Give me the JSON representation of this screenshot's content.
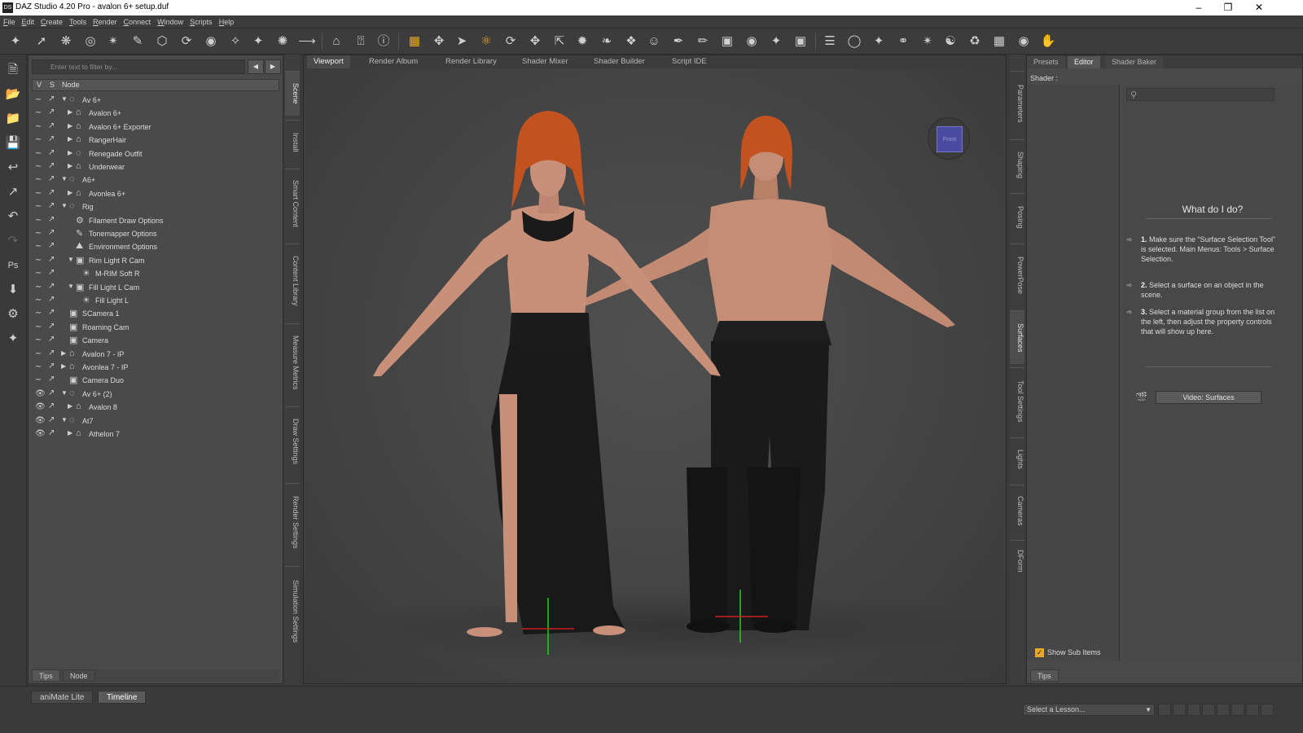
{
  "window": {
    "title": "DAZ Studio 4.20 Pro - avalon 6+ setup.duf",
    "app_icon": "DS",
    "controls": [
      "–",
      "❐",
      "✕"
    ]
  },
  "menu": [
    "File",
    "Edit",
    "Create",
    "Tools",
    "Render",
    "Connect",
    "Window",
    "Scripts",
    "Help"
  ],
  "scene_panel": {
    "filter_placeholder": "Enter text to filter by...",
    "nav_back": "◀",
    "nav_forward": "▶",
    "columns": {
      "v": "V",
      "s": "S",
      "node": "Node"
    },
    "nodes": [
      {
        "label": "Av 6+",
        "depth": 0,
        "expand": "▼",
        "icon": "◌"
      },
      {
        "label": "Avalon 6+",
        "depth": 1,
        "expand": "▶",
        "icon": "⌂"
      },
      {
        "label": "Avalon 6+ Exporter",
        "depth": 1,
        "expand": "▶",
        "icon": "⌂"
      },
      {
        "label": "RangerHair",
        "depth": 1,
        "expand": "▶",
        "icon": "⌂"
      },
      {
        "label": "Renegade Outfit",
        "depth": 1,
        "expand": "▶",
        "icon": "◌"
      },
      {
        "label": "Underwear",
        "depth": 1,
        "expand": "▶",
        "icon": "⌂"
      },
      {
        "label": "A6+",
        "depth": 0,
        "expand": "▼",
        "icon": "◌"
      },
      {
        "label": "Avonlea 6+",
        "depth": 1,
        "expand": "▶",
        "icon": "⌂"
      },
      {
        "label": "Rig",
        "depth": 0,
        "expand": "▼",
        "icon": "◌"
      },
      {
        "label": "Filament Draw Options",
        "depth": 1,
        "expand": "",
        "icon": "⚙"
      },
      {
        "label": "Tonemapper Options",
        "depth": 1,
        "expand": "",
        "icon": "✎"
      },
      {
        "label": "Environment Options",
        "depth": 1,
        "expand": "",
        "icon": "⛰"
      },
      {
        "label": "Rim Light R Cam",
        "depth": 1,
        "expand": "▼",
        "icon": "▣"
      },
      {
        "label": "M-RIM Soft R",
        "depth": 2,
        "expand": "",
        "icon": "☀"
      },
      {
        "label": "Fill Light L Cam",
        "depth": 1,
        "expand": "▼",
        "icon": "▣"
      },
      {
        "label": "Fill Light L",
        "depth": 2,
        "expand": "",
        "icon": "☀"
      },
      {
        "label": "SCamera 1",
        "depth": 0,
        "expand": "",
        "icon": "▣"
      },
      {
        "label": "Roaming Cam",
        "depth": 0,
        "expand": "",
        "icon": "▣"
      },
      {
        "label": "Camera",
        "depth": 0,
        "expand": "",
        "icon": "▣"
      },
      {
        "label": "Avalon 7 - IP",
        "depth": 0,
        "expand": "▶",
        "icon": "⌂"
      },
      {
        "label": "Avonlea 7 - IP",
        "depth": 0,
        "expand": "▶",
        "icon": "⌂"
      },
      {
        "label": "Camera Duo",
        "depth": 0,
        "expand": "",
        "icon": "▣"
      },
      {
        "label": "Av 6+ (2)",
        "depth": 0,
        "expand": "▼",
        "icon": "◌"
      },
      {
        "label": "Avalon 8",
        "depth": 1,
        "expand": "▶",
        "icon": "⌂"
      },
      {
        "label": "At7",
        "depth": 0,
        "expand": "▼",
        "icon": "◌"
      },
      {
        "label": "Athelon 7",
        "depth": 1,
        "expand": "▶",
        "icon": "⌂"
      }
    ],
    "bottom_tabs": [
      "Tips",
      "Node"
    ]
  },
  "left_vertical_tabs": [
    "Scene",
    "Install",
    "Smart Content",
    "Content Library",
    "Measure Metrics",
    "Draw Settings",
    "Render Settings",
    "Simulation Settings"
  ],
  "viewport_tabs": [
    "Viewport",
    "Render Album",
    "Render Library",
    "Shader Mixer",
    "Shader Builder",
    "Script IDE"
  ],
  "view_cube_label": "Front",
  "right_vertical_tabs": [
    "Parameters",
    "Shaping",
    "Posing",
    "PowerPose",
    "Surfaces",
    "Tool Settings",
    "Lights",
    "Cameras",
    "DForm"
  ],
  "surfaces_panel": {
    "tabs": [
      "Presets",
      "Editor",
      "Shader Baker"
    ],
    "shader_label": "Shader :",
    "help_title": "What do I do?",
    "steps": [
      {
        "num": "1.",
        "text": "Make sure the “Surface Selection Tool” is selected. Main Menus: Tools > Surface Selection."
      },
      {
        "num": "2.",
        "text": "Select a surface on an object in the scene."
      },
      {
        "num": "3.",
        "text": "Select a material group from the list on the left, then adjust the property controls that will show up here."
      }
    ],
    "video_button": "Video: Surfaces",
    "show_sub_items": "Show Sub Items",
    "tips_tab": "Tips"
  },
  "bottom_bar": {
    "tabs": [
      "aniMate Lite",
      "Timeline"
    ],
    "lesson_select": "Select a Lesson..."
  },
  "colors": {
    "accent": "#e8a928",
    "panel": "#4a4a4a",
    "background": "#3a3a3a",
    "hair": "#c2521f",
    "skin": "#c89078"
  }
}
